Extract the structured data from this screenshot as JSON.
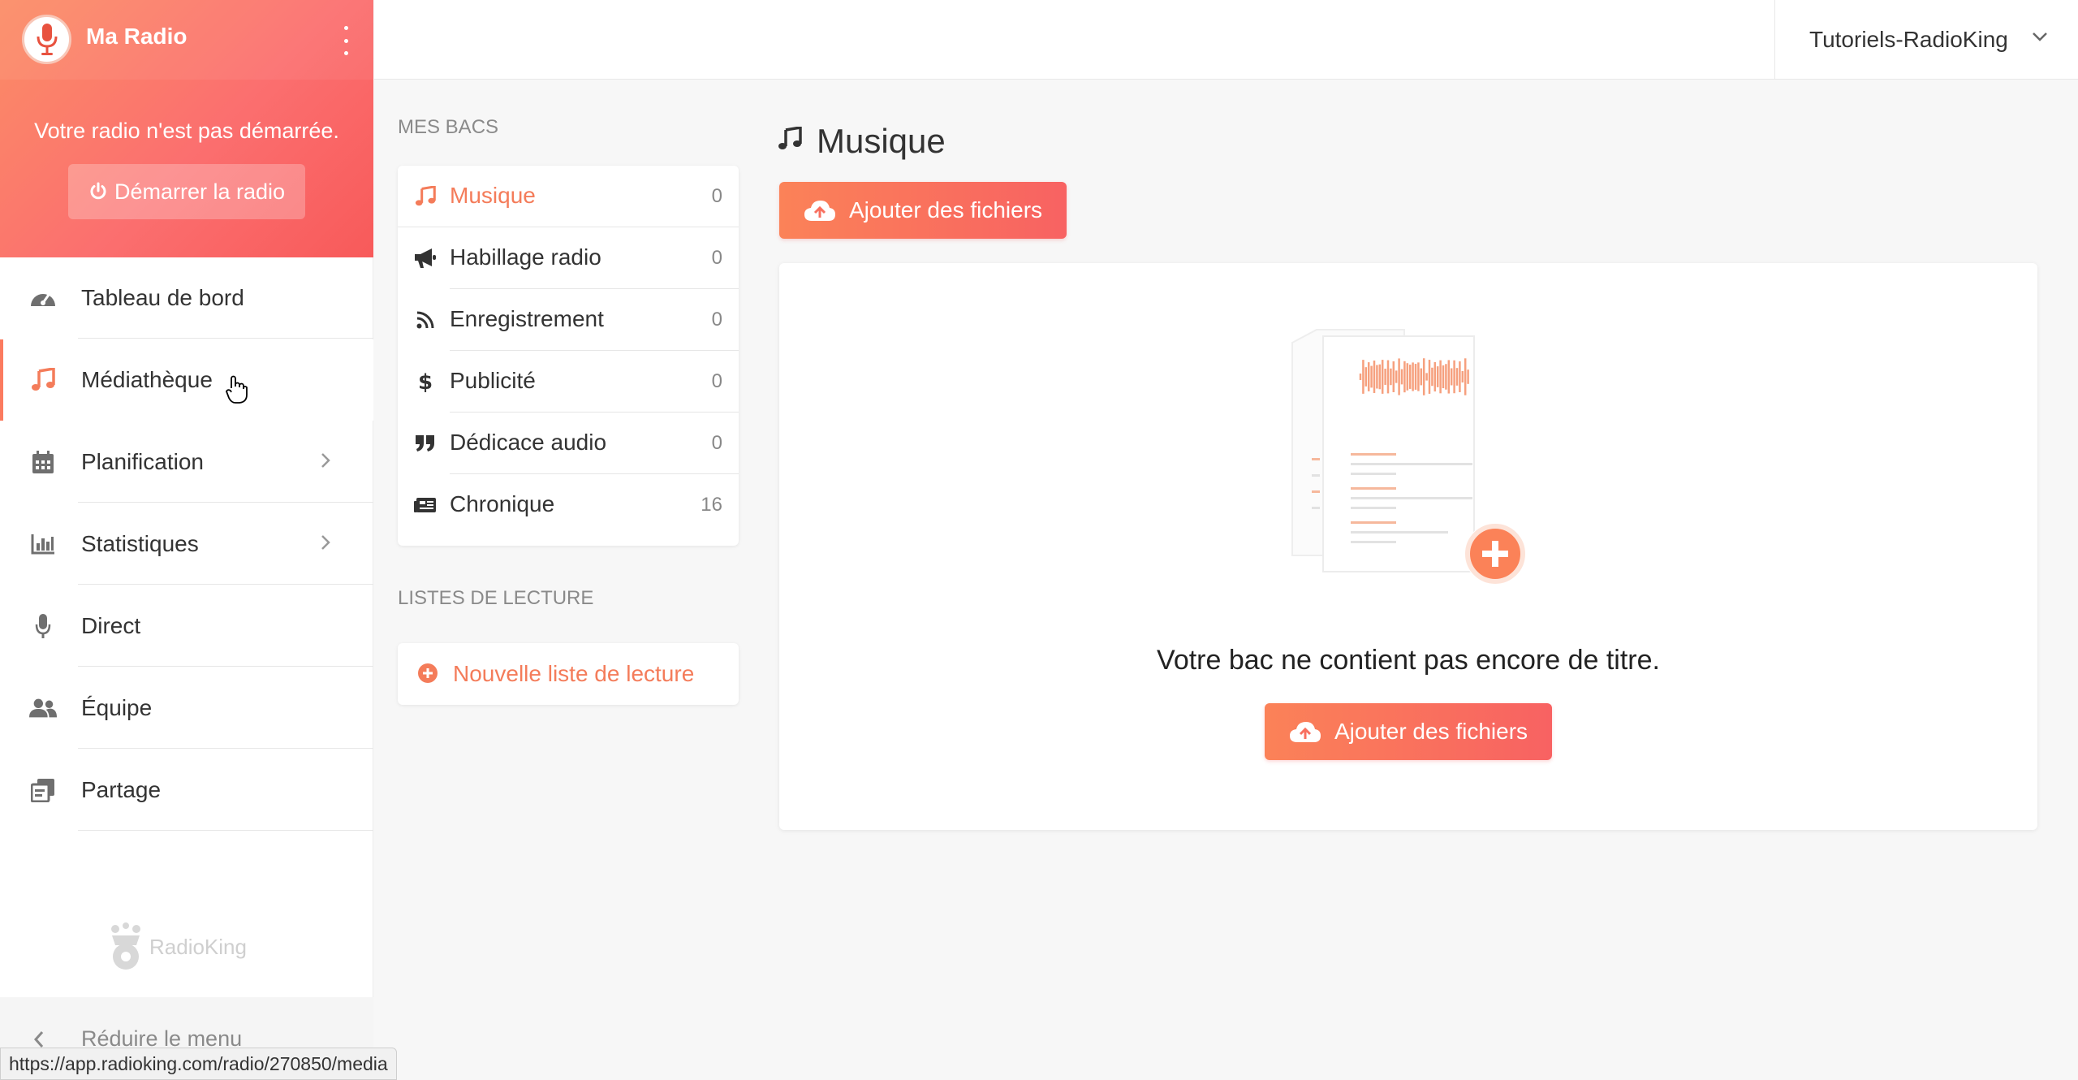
{
  "sidebar": {
    "radio_name": "Ma Radio",
    "status_text": "Votre radio n'est pas démarrée.",
    "start_button": "Démarrer la radio",
    "nav": [
      {
        "label": "Tableau de bord",
        "icon": "dashboard-icon"
      },
      {
        "label": "Médiathèque",
        "icon": "music-note-icon",
        "active": true
      },
      {
        "label": "Planification",
        "icon": "calendar-icon",
        "has_submenu": true
      },
      {
        "label": "Statistiques",
        "icon": "bar-chart-icon",
        "has_submenu": true
      },
      {
        "label": "Direct",
        "icon": "microphone-icon"
      },
      {
        "label": "Équipe",
        "icon": "users-icon"
      },
      {
        "label": "Partage",
        "icon": "share-icon"
      }
    ],
    "logo_text": "RadioKing",
    "collapse_label": "Réduire le menu"
  },
  "status_bar_url": "https://app.radioking.com/radio/270850/media",
  "header": {
    "account_name": "Tutoriels-RadioKing"
  },
  "bins": {
    "section_title": "MES BACS",
    "items": [
      {
        "label": "Musique",
        "count": "0",
        "icon": "music-note-icon",
        "active": true
      },
      {
        "label": "Habillage radio",
        "count": "0",
        "icon": "megaphone-icon"
      },
      {
        "label": "Enregistrement",
        "count": "0",
        "icon": "rss-icon"
      },
      {
        "label": "Publicité",
        "count": "0",
        "icon": "dollar-icon"
      },
      {
        "label": "Dédicace audio",
        "count": "0",
        "icon": "quote-icon"
      },
      {
        "label": "Chronique",
        "count": "16",
        "icon": "newspaper-icon"
      }
    ]
  },
  "playlists": {
    "section_title": "LISTES DE LECTURE",
    "new_label": "Nouvelle liste de lecture"
  },
  "main": {
    "title": "Musique",
    "add_files_label": "Ajouter des fichiers",
    "empty_message": "Votre bac ne contient pas encore de titre.",
    "empty_add_files_label": "Ajouter des fichiers"
  },
  "colors": {
    "accent": "#f47c5a",
    "gradient_start": "#fb8258",
    "gradient_end": "#f86262"
  }
}
